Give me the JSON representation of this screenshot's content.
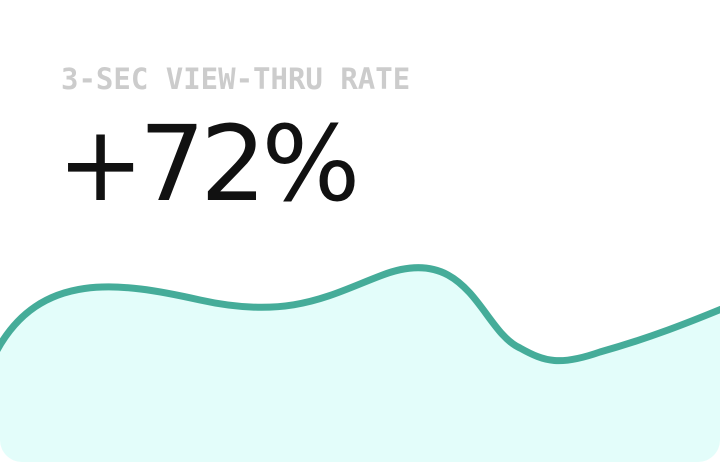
{
  "metric": {
    "label": "3-SEC VIEW-THRU RATE",
    "value": "+72%"
  },
  "sparkline": {
    "stroke_color": "#45ac99",
    "fill_color": "#e3fdfa",
    "shape": "smooth wavy area trend, no axes or labels shown"
  }
}
